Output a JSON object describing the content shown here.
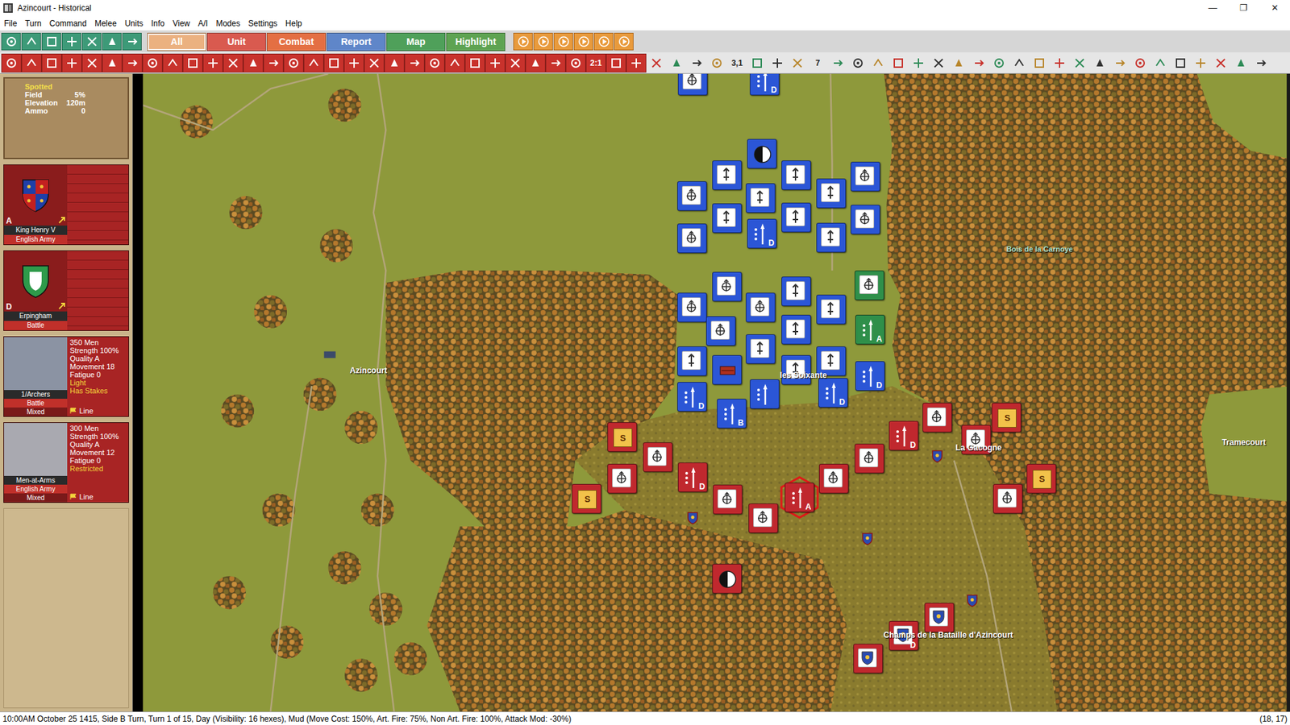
{
  "window": {
    "title": "Azincourt - Historical",
    "controls": [
      "—",
      "❐",
      "✕"
    ]
  },
  "menu": [
    "File",
    "Turn",
    "Command",
    "Melee",
    "Units",
    "Info",
    "View",
    "A/I",
    "Modes",
    "Settings",
    "Help"
  ],
  "tabs": [
    {
      "label": "All",
      "selected": true,
      "color": "#e8a46a"
    },
    {
      "label": "Unit",
      "selected": false,
      "color": "#d95a4f"
    },
    {
      "label": "Combat",
      "selected": false,
      "color": "#e46f43"
    },
    {
      "label": "Report",
      "selected": false,
      "color": "#5f86c9"
    },
    {
      "label": "Map",
      "selected": false,
      "color": "#4fa05a"
    },
    {
      "label": "Highlight",
      "selected": false,
      "color": "#5ea352"
    }
  ],
  "toolbar2": [
    {
      "kind": "icon"
    },
    {
      "kind": "icon"
    },
    {
      "kind": "icon"
    },
    {
      "kind": "icon"
    },
    {
      "kind": "icon"
    },
    {
      "kind": "icon"
    },
    {
      "kind": "icon"
    },
    {
      "kind": "icon"
    },
    {
      "kind": "icon"
    },
    {
      "kind": "icon"
    },
    {
      "kind": "icon"
    },
    {
      "kind": "icon"
    },
    {
      "kind": "icon"
    },
    {
      "kind": "icon"
    },
    {
      "kind": "icon"
    },
    {
      "kind": "icon"
    },
    {
      "kind": "icon"
    },
    {
      "kind": "icon"
    },
    {
      "kind": "icon"
    },
    {
      "kind": "icon"
    },
    {
      "kind": "icon"
    },
    {
      "kind": "icon"
    },
    {
      "kind": "icon"
    },
    {
      "kind": "icon"
    },
    {
      "kind": "icon"
    },
    {
      "kind": "icon"
    },
    {
      "kind": "icon"
    },
    {
      "kind": "icon"
    },
    {
      "kind": "icon"
    },
    {
      "kind": "text",
      "label": "2:1"
    },
    {
      "kind": "icon"
    },
    {
      "kind": "icon"
    },
    {
      "kind": "icon"
    },
    {
      "kind": "icon"
    },
    {
      "kind": "icon"
    },
    {
      "kind": "icon"
    },
    {
      "kind": "text",
      "label": "3,1"
    },
    {
      "kind": "icon"
    },
    {
      "kind": "icon"
    },
    {
      "kind": "icon"
    },
    {
      "kind": "text",
      "label": "7"
    },
    {
      "kind": "icon"
    },
    {
      "kind": "icon"
    },
    {
      "kind": "icon"
    },
    {
      "kind": "icon"
    },
    {
      "kind": "icon"
    },
    {
      "kind": "icon"
    },
    {
      "kind": "icon"
    },
    {
      "kind": "icon"
    },
    {
      "kind": "icon"
    },
    {
      "kind": "icon"
    },
    {
      "kind": "icon"
    },
    {
      "kind": "icon"
    },
    {
      "kind": "icon"
    },
    {
      "kind": "icon"
    },
    {
      "kind": "icon"
    },
    {
      "kind": "icon"
    },
    {
      "kind": "icon"
    },
    {
      "kind": "icon"
    },
    {
      "kind": "icon"
    },
    {
      "kind": "icon"
    },
    {
      "kind": "icon"
    },
    {
      "kind": "icon"
    }
  ],
  "terrain": {
    "status": "Spotted",
    "rows": [
      {
        "label": "Field",
        "value": "5%"
      },
      {
        "label": "Elevation",
        "value": "120m"
      },
      {
        "label": "Ammo",
        "value": "0"
      }
    ]
  },
  "leaders": [
    {
      "rating": "A",
      "name": "King Henry V",
      "command": "English Army",
      "kind": "royal"
    },
    {
      "rating": "D",
      "name": "Erpingham",
      "command": "Battle",
      "kind": "knight"
    }
  ],
  "units": [
    {
      "name": "1/Archers",
      "command": "Battle",
      "mix": "Mixed",
      "formation": "Line",
      "kind": "archer",
      "stats": [
        "350 Men",
        "Strength 100%",
        "Quality A",
        "Movement 18",
        "Fatigue 0"
      ],
      "traits": [
        "Light",
        "Has Stakes"
      ]
    },
    {
      "name": "Men-at-Arms",
      "command": "English Army",
      "mix": "Mixed",
      "formation": "Line",
      "kind": "knight",
      "stats": [
        "300 Men",
        "Strength 100%",
        "Quality A",
        "Movement 12",
        "Fatigue 0"
      ],
      "traits": [
        "Restricted"
      ]
    }
  ],
  "map": {
    "labels": [
      {
        "text": "Azincourt"
      },
      {
        "text": "Bois de la Carnoye"
      },
      {
        "text": "les Soixante"
      },
      {
        "text": "La Gacogne"
      },
      {
        "text": "Tramecourt"
      },
      {
        "text": "Champs de la Bataille d'Azincourt"
      }
    ],
    "counters": [
      {
        "color": "#2b56d6",
        "kind": "archer",
        "badge": "",
        "selected": false
      },
      {
        "color": "#2b56d6",
        "kind": "spear",
        "badge": "D",
        "selected": false
      },
      {
        "color": "#2b56d6",
        "kind": "leader",
        "badge": "",
        "selected": false
      },
      {
        "color": "#2b56d6",
        "kind": "mat",
        "badge": "",
        "selected": false
      },
      {
        "color": "#2b56d6",
        "kind": "mat",
        "badge": "",
        "selected": false
      },
      {
        "color": "#2b56d6",
        "kind": "archer",
        "badge": "",
        "selected": false
      },
      {
        "color": "#2b56d6",
        "kind": "mat",
        "badge": "",
        "selected": false
      },
      {
        "color": "#2b56d6",
        "kind": "archer",
        "badge": "",
        "selected": false
      },
      {
        "color": "#2b56d6",
        "kind": "mat",
        "badge": "",
        "selected": false
      },
      {
        "color": "#2b56d6",
        "kind": "mat",
        "badge": "",
        "selected": false
      },
      {
        "color": "#2b56d6",
        "kind": "mat",
        "badge": "",
        "selected": false
      },
      {
        "color": "#2b56d6",
        "kind": "archer",
        "badge": "",
        "selected": false
      },
      {
        "color": "#2b56d6",
        "kind": "mat",
        "badge": "",
        "selected": false
      },
      {
        "color": "#2b56d6",
        "kind": "archer",
        "badge": "",
        "selected": false
      },
      {
        "color": "#2b56d6",
        "kind": "spear",
        "badge": "D",
        "selected": false
      },
      {
        "color": "#2b56d6",
        "kind": "archer",
        "badge": "",
        "selected": false
      },
      {
        "color": "#2b56d6",
        "kind": "mat",
        "badge": "",
        "selected": false
      },
      {
        "color": "#2f8f4a",
        "kind": "archer",
        "badge": "",
        "selected": false
      },
      {
        "color": "#2b56d6",
        "kind": "archer",
        "badge": "",
        "selected": false
      },
      {
        "color": "#2b56d6",
        "kind": "archer",
        "badge": "",
        "selected": false
      },
      {
        "color": "#2b56d6",
        "kind": "mat",
        "badge": "",
        "selected": false
      },
      {
        "color": "#2b56d6",
        "kind": "archer",
        "badge": "",
        "selected": false
      },
      {
        "color": "#2b56d6",
        "kind": "mat",
        "badge": "",
        "selected": false
      },
      {
        "color": "#2f8f4a",
        "kind": "spear",
        "badge": "A",
        "selected": false
      },
      {
        "color": "#2b56d6",
        "kind": "mat",
        "badge": "",
        "selected": false
      },
      {
        "color": "#2b56d6",
        "kind": "gun",
        "badge": "",
        "selected": false
      },
      {
        "color": "#2b56d6",
        "kind": "mat",
        "badge": "",
        "selected": false
      },
      {
        "color": "#2b56d6",
        "kind": "mat",
        "badge": "",
        "selected": false
      },
      {
        "color": "#2b56d6",
        "kind": "mat",
        "badge": "",
        "selected": false
      },
      {
        "color": "#2b56d6",
        "kind": "spear",
        "badge": "D",
        "selected": false
      },
      {
        "color": "#2b56d6",
        "kind": "spear",
        "badge": "D",
        "selected": false
      },
      {
        "color": "#2b56d6",
        "kind": "spear",
        "badge": "",
        "selected": false
      },
      {
        "color": "#2b56d6",
        "kind": "spear",
        "badge": "D",
        "selected": false
      },
      {
        "color": "#2b56d6",
        "kind": "spear",
        "badge": "B",
        "selected": false
      },
      {
        "color": "#c0282e",
        "kind": "supply",
        "badge": "S",
        "selected": false
      },
      {
        "color": "#c0282e",
        "kind": "archer",
        "badge": "",
        "selected": false
      },
      {
        "color": "#c0282e",
        "kind": "archer",
        "badge": "",
        "selected": false
      },
      {
        "color": "#c0282e",
        "kind": "supply",
        "badge": "S",
        "selected": false
      },
      {
        "color": "#c0282e",
        "kind": "spear",
        "badge": "D",
        "selected": false
      },
      {
        "color": "#c0282e",
        "kind": "archer",
        "badge": "",
        "selected": false
      },
      {
        "color": "#c0282e",
        "kind": "archer",
        "badge": "",
        "selected": false
      },
      {
        "color": "#c0282e",
        "kind": "spear",
        "badge": "A",
        "selected": true
      },
      {
        "color": "#c0282e",
        "kind": "archer",
        "badge": "",
        "selected": false
      },
      {
        "color": "#c0282e",
        "kind": "archer",
        "badge": "",
        "selected": false
      },
      {
        "color": "#c0282e",
        "kind": "spear",
        "badge": "D",
        "selected": false
      },
      {
        "color": "#c0282e",
        "kind": "archer",
        "badge": "",
        "selected": false
      },
      {
        "color": "#c0282e",
        "kind": "archer",
        "badge": "",
        "selected": false
      },
      {
        "color": "#c0282e",
        "kind": "supply",
        "badge": "S",
        "selected": false
      },
      {
        "color": "#c0282e",
        "kind": "supply",
        "badge": "S",
        "selected": false
      },
      {
        "color": "#c0282e",
        "kind": "archer",
        "badge": "",
        "selected": false
      },
      {
        "color": "#c0282e",
        "kind": "leader",
        "badge": "",
        "selected": false
      },
      {
        "color": "#c0282e",
        "kind": "banner",
        "badge": "",
        "selected": false
      },
      {
        "color": "#c0282e",
        "kind": "banner",
        "badge": "D",
        "selected": false
      },
      {
        "color": "#c0282e",
        "kind": "banner",
        "badge": "",
        "selected": false
      }
    ]
  },
  "status_bar": {
    "text": "10:00AM October 25 1415, Side B Turn, Turn 1 of 15, Day (Visibility: 16 hexes), Mud (Move Cost: 150%, Art. Fire: 75%, Non Art. Fire: 100%, Attack Mod: -30%)",
    "coords": "(18, 17)"
  }
}
